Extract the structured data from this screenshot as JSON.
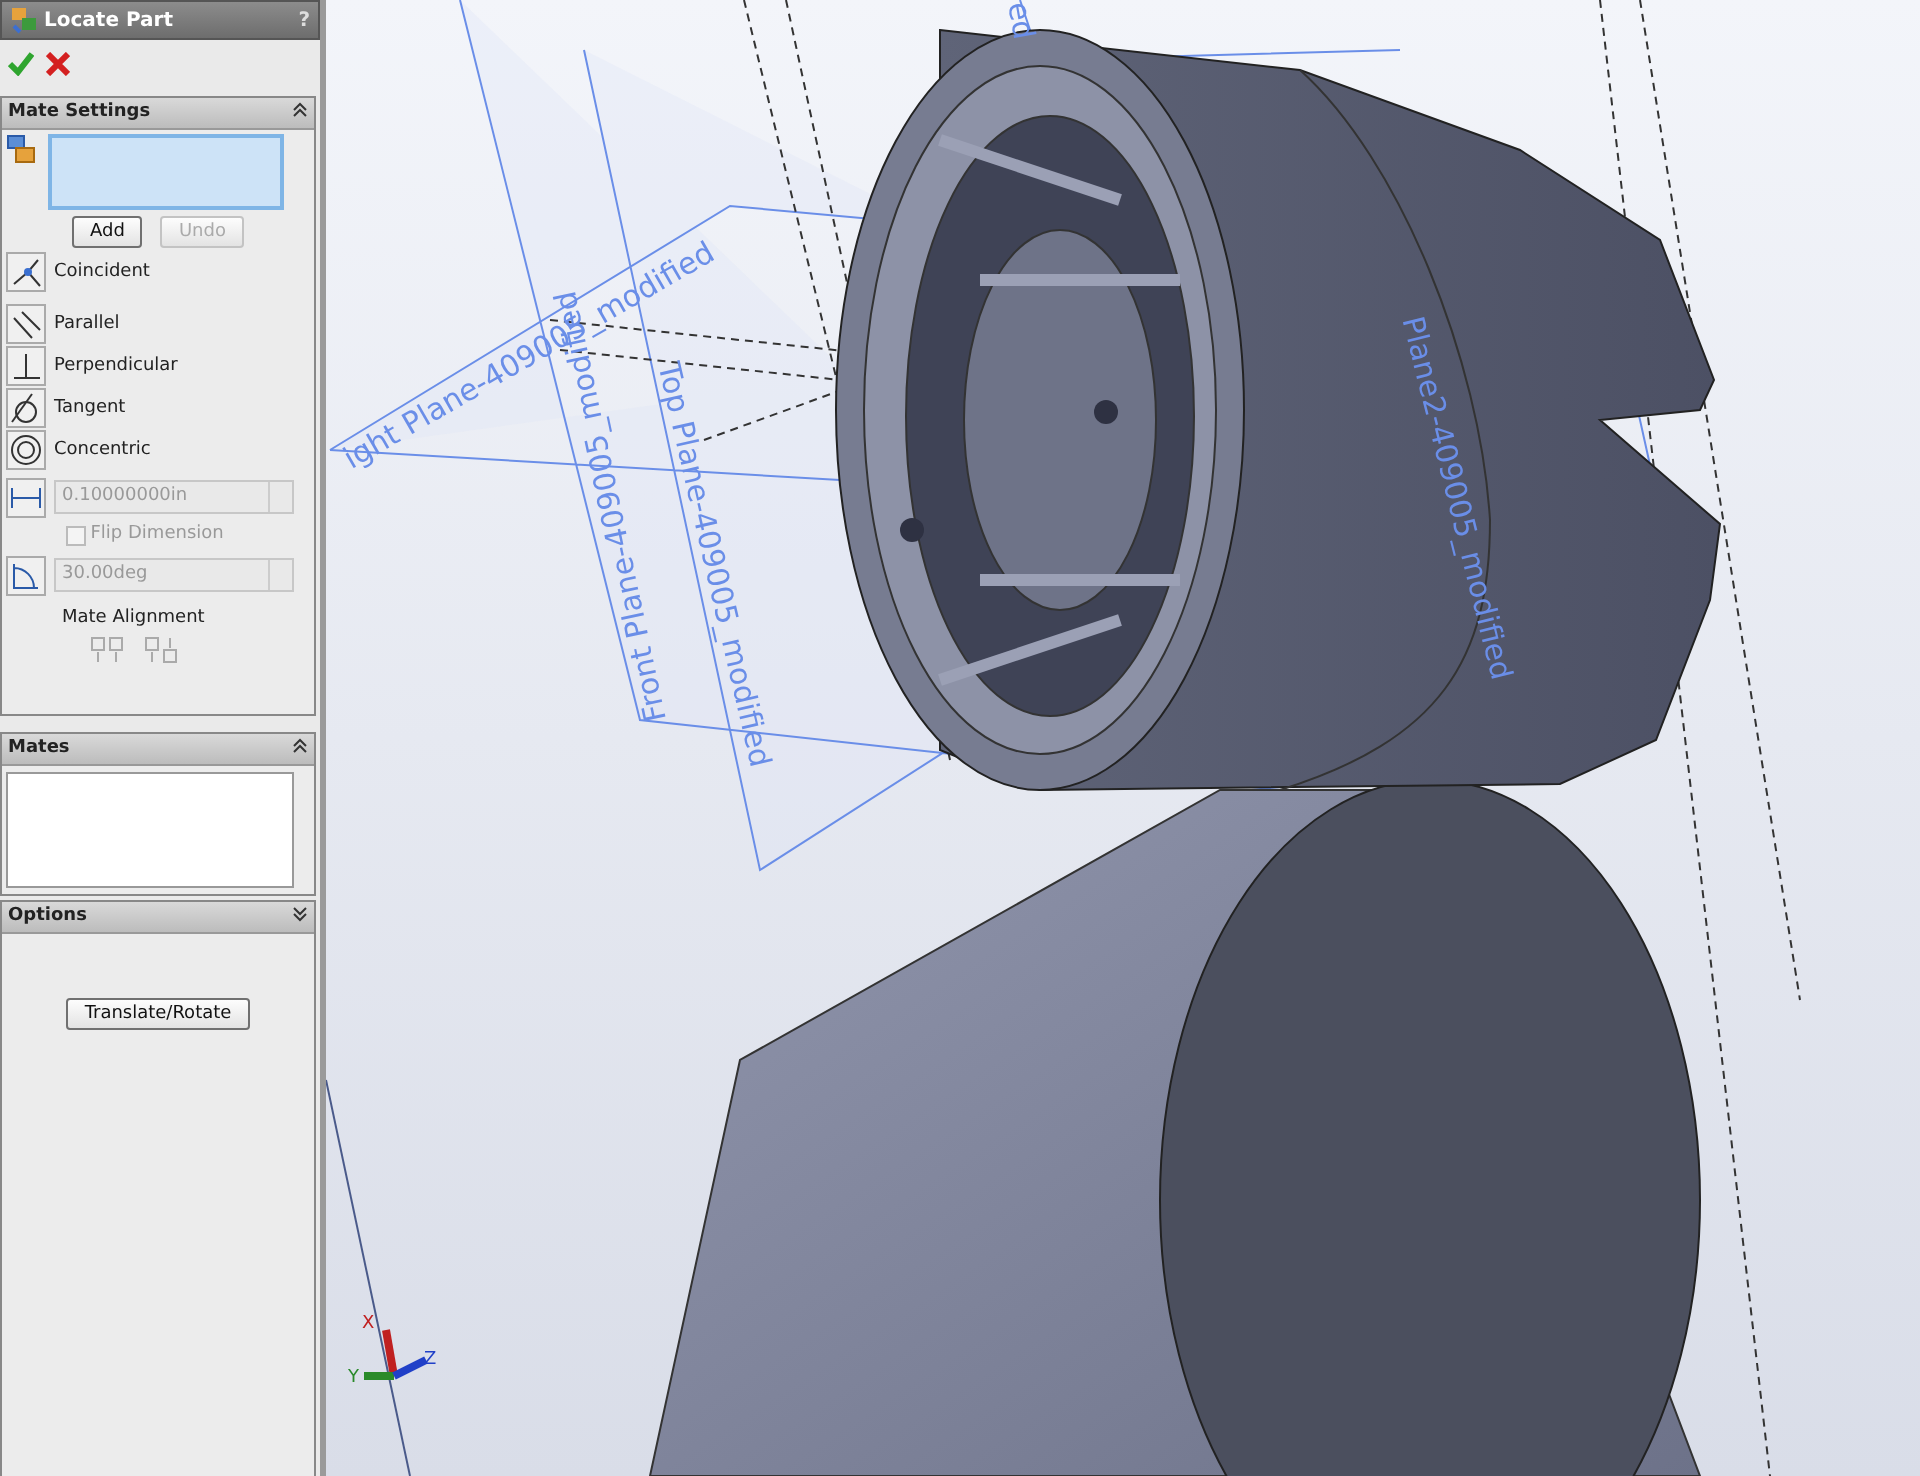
{
  "window": {
    "title": "Locate Part",
    "help": "?"
  },
  "mate_settings": {
    "title": "Mate Settings",
    "expanded": true,
    "buttons": [
      {
        "label": "Add",
        "disabled": false
      },
      {
        "label": "Undo",
        "disabled": true
      }
    ],
    "mate_types": [
      {
        "kind": "coincident",
        "label": "Coincident",
        "selected": false
      },
      {
        "kind": "parallel",
        "label": "Parallel",
        "selected": false
      },
      {
        "kind": "perpendicular",
        "label": "Perpendicular",
        "selected": false
      },
      {
        "kind": "tangent",
        "label": "Tangent",
        "selected": false
      },
      {
        "kind": "concentric",
        "label": "Concentric",
        "selected": false
      }
    ],
    "distance": {
      "value": "0.10000000in",
      "disabled": true
    },
    "flip_dimension": {
      "label": "Flip Dimension",
      "checked": false,
      "disabled": true
    },
    "angle": {
      "value": "30.00deg",
      "disabled": true
    },
    "mate_alignment": {
      "label": "Mate Alignment"
    }
  },
  "mates_panel": {
    "title": "Mates",
    "expanded": true
  },
  "options_panel": {
    "title": "Options",
    "expanded": false,
    "button": "Translate/Rotate"
  },
  "viewport": {
    "plane_labels": [
      {
        "text": "ight Plane-409005_modified"
      },
      {
        "text": "Front Plane-409005_modified"
      },
      {
        "text": "Top Plane-409005_modified"
      },
      {
        "text": "Plane2-409005_modified"
      },
      {
        "text": "ed"
      }
    ],
    "triad_labels": [
      "X",
      "Y",
      "Z"
    ]
  }
}
